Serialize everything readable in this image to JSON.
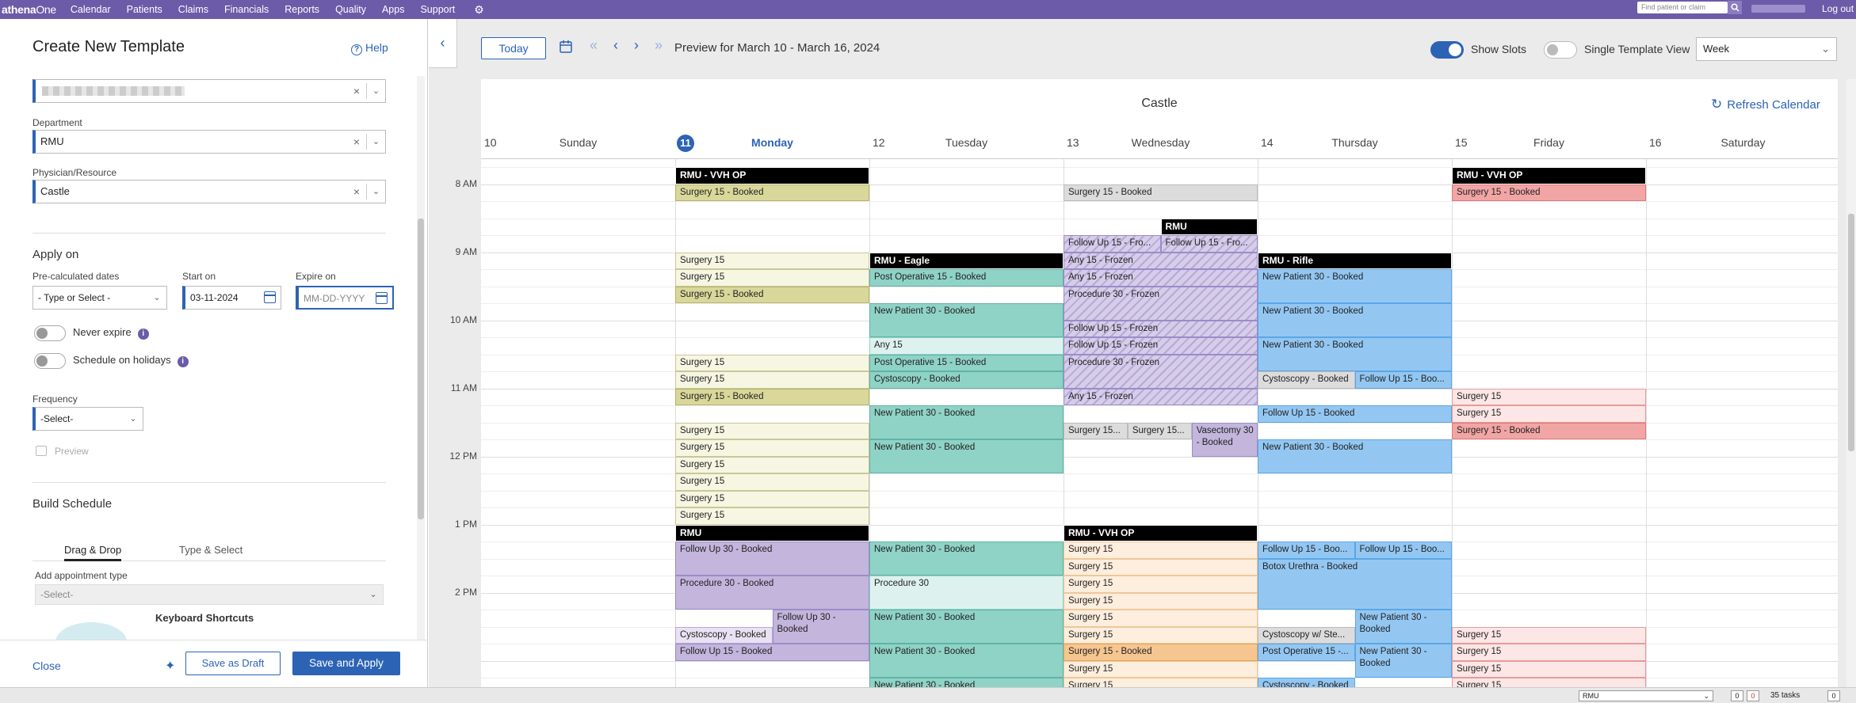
{
  "topnav": {
    "logo_bold": "athena",
    "logo_rest": "One",
    "items": [
      "Calendar",
      "Patients",
      "Claims",
      "Financials",
      "Reports",
      "Quality",
      "Apps",
      "Support"
    ],
    "search_placeholder": "Find patient or claim",
    "logout": "Log out"
  },
  "panel": {
    "title": "Create New Template",
    "help": "Help",
    "department_label": "Department",
    "department_value": "RMU",
    "physician_label": "Physician/Resource",
    "physician_value": "Castle",
    "apply_on_title": "Apply on",
    "precalc_label": "Pre-calculated dates",
    "precalc_value": "- Type or Select -",
    "start_label": "Start on",
    "start_value": "03-11-2024",
    "expire_label": "Expire on",
    "expire_placeholder": "MM-DD-YYYY",
    "never_expire": "Never expire",
    "schedule_holidays": "Schedule on holidays",
    "frequency_label": "Frequency",
    "frequency_value": "-Select-",
    "preview": "Preview",
    "build_schedule": "Build Schedule",
    "tab_drag": "Drag & Drop",
    "tab_type": "Type & Select",
    "add_appt_label": "Add appointment type",
    "add_appt_value": "-Select-",
    "keyboard_shortcuts": "Keyboard Shortcuts",
    "close": "Close",
    "save_draft": "Save as Draft",
    "save_apply": "Save and Apply"
  },
  "toolbar": {
    "today": "Today",
    "preview_label": "Preview for March 10 - March 16, 2024",
    "show_slots": "Show Slots",
    "single_template_view": "Single Template View",
    "view_value": "Week"
  },
  "calendar": {
    "title": "Castle",
    "refresh": "Refresh Calendar",
    "days": [
      {
        "num": "10",
        "name": "Sunday"
      },
      {
        "num": "11",
        "name": "Monday",
        "today": true
      },
      {
        "num": "12",
        "name": "Tuesday"
      },
      {
        "num": "13",
        "name": "Wednesday"
      },
      {
        "num": "14",
        "name": "Thursday"
      },
      {
        "num": "15",
        "name": "Friday"
      },
      {
        "num": "16",
        "name": "Saturday"
      }
    ],
    "times": [
      "8 AM",
      "9 AM",
      "10 AM",
      "11 AM",
      "12 PM",
      "1 PM",
      "2 PM"
    ],
    "events": [
      {
        "day": 1,
        "col": 0,
        "cols": 1,
        "start": 0,
        "len": 1,
        "type": "hdr",
        "text": "RMU - VVH OP"
      },
      {
        "day": 1,
        "col": 0,
        "cols": 1,
        "start": 1,
        "len": 1,
        "type": "yellow",
        "text": "Surgery 15 - Booked"
      },
      {
        "day": 5,
        "col": 0,
        "cols": 1,
        "start": 0,
        "len": 1,
        "type": "hdr",
        "text": "RMU - VVH OP"
      },
      {
        "day": 5,
        "col": 0,
        "cols": 1,
        "start": 1,
        "len": 1,
        "type": "red",
        "text": "Surgery 15 - Booked"
      },
      {
        "day": 3,
        "col": 0,
        "cols": 1,
        "start": 1,
        "len": 1,
        "type": "gray",
        "text": "Surgery 15 - Booked"
      },
      {
        "day": 3,
        "col": 0.5,
        "cols": 0.5,
        "start": 3,
        "len": 1,
        "type": "hdr",
        "text": "RMU"
      },
      {
        "day": 3,
        "col": 0,
        "cols": 0.5,
        "start": 4,
        "len": 1,
        "type": "purpleh",
        "text": "Follow Up 15 - Fro..."
      },
      {
        "day": 3,
        "col": 0.5,
        "cols": 0.5,
        "start": 4,
        "len": 1,
        "type": "purpleh",
        "text": "Follow Up 15 - Fro..."
      },
      {
        "day": 1,
        "col": 0,
        "cols": 1,
        "start": 5,
        "len": 1,
        "type": "yellowl",
        "text": "Surgery 15"
      },
      {
        "day": 1,
        "col": 0,
        "cols": 1,
        "start": 6,
        "len": 1,
        "type": "yellowl",
        "text": "Surgery 15"
      },
      {
        "day": 1,
        "col": 0,
        "cols": 1,
        "start": 7,
        "len": 1,
        "type": "yellow",
        "text": "Surgery 15 - Booked"
      },
      {
        "day": 2,
        "col": 0,
        "cols": 1,
        "start": 5,
        "len": 1,
        "type": "hdr",
        "text": "RMU - Eagle"
      },
      {
        "day": 2,
        "col": 0,
        "cols": 1,
        "start": 6,
        "len": 1,
        "type": "teal",
        "text": "Post Operative 15 - Booked"
      },
      {
        "day": 2,
        "col": 0,
        "cols": 1,
        "start": 8,
        "len": 2,
        "type": "teal",
        "text": "New Patient 30 - Booked"
      },
      {
        "day": 2,
        "col": 0,
        "cols": 1,
        "start": 10,
        "len": 1,
        "type": "teall",
        "text": "Any 15"
      },
      {
        "day": 2,
        "col": 0,
        "cols": 1,
        "start": 11,
        "len": 1,
        "type": "teal",
        "text": "Post Operative 15 - Booked"
      },
      {
        "day": 2,
        "col": 0,
        "cols": 1,
        "start": 12,
        "len": 1,
        "type": "teal",
        "text": "Cystoscopy - Booked"
      },
      {
        "day": 2,
        "col": 0,
        "cols": 1,
        "start": 14,
        "len": 2,
        "type": "teal",
        "text": "New Patient 30 - Booked"
      },
      {
        "day": 2,
        "col": 0,
        "cols": 1,
        "start": 16,
        "len": 2,
        "type": "teal",
        "text": "New Patient 30 - Booked"
      },
      {
        "day": 3,
        "col": 0,
        "cols": 1,
        "start": 5,
        "len": 1,
        "type": "purpleh",
        "text": "Any 15 - Frozen"
      },
      {
        "day": 3,
        "col": 0,
        "cols": 1,
        "start": 6,
        "len": 1,
        "type": "purpleh",
        "text": "Any 15 - Frozen"
      },
      {
        "day": 3,
        "col": 0,
        "cols": 1,
        "start": 7,
        "len": 2,
        "type": "purpleh",
        "text": "Procedure 30 - Frozen"
      },
      {
        "day": 3,
        "col": 0,
        "cols": 1,
        "start": 9,
        "len": 1,
        "type": "purpleh",
        "text": "Follow Up 15 - Frozen"
      },
      {
        "day": 3,
        "col": 0,
        "cols": 1,
        "start": 10,
        "len": 1,
        "type": "purpleh",
        "text": "Follow Up 15 - Frozen"
      },
      {
        "day": 3,
        "col": 0,
        "cols": 1,
        "start": 11,
        "len": 2,
        "type": "purpleh",
        "text": "Procedure 30 - Frozen"
      },
      {
        "day": 3,
        "col": 0,
        "cols": 1,
        "start": 13,
        "len": 1,
        "type": "purpleh",
        "text": "Any 15 - Frozen"
      },
      {
        "day": 4,
        "col": 0,
        "cols": 1,
        "start": 5,
        "len": 1,
        "type": "hdr",
        "text": "RMU - Rifle"
      },
      {
        "day": 4,
        "col": 0,
        "cols": 1,
        "start": 6,
        "len": 2,
        "type": "blue",
        "text": "New Patient 30 - Booked"
      },
      {
        "day": 4,
        "col": 0,
        "cols": 1,
        "start": 8,
        "len": 2,
        "type": "blue",
        "text": "New Patient 30 - Booked"
      },
      {
        "day": 4,
        "col": 0,
        "cols": 1,
        "start": 10,
        "len": 2,
        "type": "blue",
        "text": "New Patient 30 - Booked"
      },
      {
        "day": 4,
        "col": 0,
        "cols": 0.5,
        "start": 12,
        "len": 1,
        "type": "gray",
        "text": "Cystoscopy - Booked"
      },
      {
        "day": 4,
        "col": 0.5,
        "cols": 0.5,
        "start": 12,
        "len": 1,
        "type": "blue",
        "text": "Follow Up 15 - Boo..."
      },
      {
        "day": 4,
        "col": 0,
        "cols": 1,
        "start": 14,
        "len": 1,
        "type": "blue",
        "text": "Follow Up 15 - Booked"
      },
      {
        "day": 4,
        "col": 0,
        "cols": 1,
        "start": 16,
        "len": 2,
        "type": "blue",
        "text": "New Patient 30 - Booked"
      },
      {
        "day": 1,
        "col": 0,
        "cols": 1,
        "start": 11,
        "len": 1,
        "type": "yellowl",
        "text": "Surgery 15"
      },
      {
        "day": 1,
        "col": 0,
        "cols": 1,
        "start": 12,
        "len": 1,
        "type": "yellowl",
        "text": "Surgery 15"
      },
      {
        "day": 1,
        "col": 0,
        "cols": 1,
        "start": 13,
        "len": 1,
        "type": "yellow",
        "text": "Surgery 15 - Booked"
      },
      {
        "day": 1,
        "col": 0,
        "cols": 1,
        "start": 15,
        "len": 1,
        "type": "yellowl",
        "text": "Surgery 15"
      },
      {
        "day": 1,
        "col": 0,
        "cols": 1,
        "start": 16,
        "len": 1,
        "type": "yellowl",
        "text": "Surgery 15"
      },
      {
        "day": 1,
        "col": 0,
        "cols": 1,
        "start": 17,
        "len": 1,
        "type": "yellowl",
        "text": "Surgery 15"
      },
      {
        "day": 1,
        "col": 0,
        "cols": 1,
        "start": 18,
        "len": 1,
        "type": "yellowl",
        "text": "Surgery 15"
      },
      {
        "day": 1,
        "col": 0,
        "cols": 1,
        "start": 19,
        "len": 1,
        "type": "yellowl",
        "text": "Surgery 15"
      },
      {
        "day": 1,
        "col": 0,
        "cols": 1,
        "start": 20,
        "len": 1,
        "type": "yellowl",
        "text": "Surgery 15"
      },
      {
        "day": 3,
        "col": 0,
        "cols": 0.33,
        "start": 15,
        "len": 1,
        "type": "gray",
        "text": "Surgery 15..."
      },
      {
        "day": 3,
        "col": 0.33,
        "cols": 0.33,
        "start": 15,
        "len": 1,
        "type": "gray",
        "text": "Surgery 15..."
      },
      {
        "day": 3,
        "col": 0.66,
        "cols": 0.34,
        "start": 15,
        "len": 2,
        "type": "purple",
        "text": "Vasectomy 30 - Booked",
        "wrap": true
      },
      {
        "day": 5,
        "col": 0,
        "cols": 1,
        "start": 13,
        "len": 1,
        "type": "redl",
        "text": "Surgery 15"
      },
      {
        "day": 5,
        "col": 0,
        "cols": 1,
        "start": 14,
        "len": 1,
        "type": "redl",
        "text": "Surgery 15"
      },
      {
        "day": 5,
        "col": 0,
        "cols": 1,
        "start": 15,
        "len": 1,
        "type": "red",
        "text": "Surgery 15 - Booked"
      },
      {
        "day": 1,
        "col": 0,
        "cols": 1,
        "start": 21,
        "len": 1,
        "type": "hdr",
        "text": "RMU"
      },
      {
        "day": 1,
        "col": 0,
        "cols": 1,
        "start": 22,
        "len": 2,
        "type": "purple",
        "text": "Follow Up 30 - Booked"
      },
      {
        "day": 1,
        "col": 0,
        "cols": 1,
        "start": 24,
        "len": 2,
        "type": "purple",
        "text": "Procedure 30 - Booked"
      },
      {
        "day": 1,
        "col": 0.5,
        "cols": 0.5,
        "start": 26,
        "len": 2,
        "type": "purple",
        "text": "Follow Up 30 - Booked",
        "wrap": true
      },
      {
        "day": 1,
        "col": 0,
        "cols": 0.5,
        "start": 27,
        "len": 1,
        "type": "purplel",
        "text": "Cystoscopy - Booked"
      },
      {
        "day": 1,
        "col": 0,
        "cols": 1,
        "start": 28,
        "len": 1,
        "type": "purple",
        "text": "Follow Up 15 - Booked"
      },
      {
        "day": 2,
        "col": 0,
        "cols": 1,
        "start": 22,
        "len": 2,
        "type": "teal",
        "text": "New Patient 30 - Booked"
      },
      {
        "day": 2,
        "col": 0,
        "cols": 1,
        "start": 24,
        "len": 2,
        "type": "teall",
        "text": "Procedure 30"
      },
      {
        "day": 2,
        "col": 0,
        "cols": 1,
        "start": 26,
        "len": 2,
        "type": "teal",
        "text": "New Patient 30 - Booked"
      },
      {
        "day": 2,
        "col": 0,
        "cols": 1,
        "start": 28,
        "len": 2,
        "type": "teal",
        "text": "New Patient 30 - Booked"
      },
      {
        "day": 2,
        "col": 0,
        "cols": 1,
        "start": 30,
        "len": 1,
        "type": "teal",
        "text": "New Patient 30 - Booked"
      },
      {
        "day": 3,
        "col": 0,
        "cols": 1,
        "start": 21,
        "len": 1,
        "type": "hdr",
        "text": "RMU - VVH OP"
      },
      {
        "day": 3,
        "col": 0,
        "cols": 1,
        "start": 22,
        "len": 1,
        "type": "orangel",
        "text": "Surgery 15"
      },
      {
        "day": 3,
        "col": 0,
        "cols": 1,
        "start": 23,
        "len": 1,
        "type": "orangel",
        "text": "Surgery 15"
      },
      {
        "day": 3,
        "col": 0,
        "cols": 1,
        "start": 24,
        "len": 1,
        "type": "orangel",
        "text": "Surgery 15"
      },
      {
        "day": 3,
        "col": 0,
        "cols": 1,
        "start": 25,
        "len": 1,
        "type": "orangel",
        "text": "Surgery 15"
      },
      {
        "day": 3,
        "col": 0,
        "cols": 1,
        "start": 26,
        "len": 1,
        "type": "orangel",
        "text": "Surgery 15"
      },
      {
        "day": 3,
        "col": 0,
        "cols": 1,
        "start": 27,
        "len": 1,
        "type": "orangel",
        "text": "Surgery 15"
      },
      {
        "day": 3,
        "col": 0,
        "cols": 1,
        "start": 28,
        "len": 1,
        "type": "orange",
        "text": "Surgery 15 - Booked"
      },
      {
        "day": 3,
        "col": 0,
        "cols": 1,
        "start": 29,
        "len": 1,
        "type": "orangel",
        "text": "Surgery 15"
      },
      {
        "day": 3,
        "col": 0,
        "cols": 1,
        "start": 30,
        "len": 1,
        "type": "orangel",
        "text": "Surgery 15"
      },
      {
        "day": 4,
        "col": 0,
        "cols": 0.5,
        "start": 22,
        "len": 1,
        "type": "blue",
        "text": "Follow Up 15 - Boo..."
      },
      {
        "day": 4,
        "col": 0.5,
        "cols": 0.5,
        "start": 22,
        "len": 1,
        "type": "blue",
        "text": "Follow Up 15 - Boo..."
      },
      {
        "day": 4,
        "col": 0,
        "cols": 1,
        "start": 23,
        "len": 3,
        "type": "blue",
        "text": "Botox Urethra - Booked"
      },
      {
        "day": 4,
        "col": 0.5,
        "cols": 0.5,
        "start": 26,
        "len": 2,
        "type": "blue",
        "text": "New Patient 30 - Booked",
        "wrap": true
      },
      {
        "day": 4,
        "col": 0,
        "cols": 0.5,
        "start": 27,
        "len": 1,
        "type": "gray",
        "text": "Cystoscopy w/ Ste..."
      },
      {
        "day": 4,
        "col": 0,
        "cols": 0.5,
        "start": 28,
        "len": 1,
        "type": "blue",
        "text": "Post Operative 15 -..."
      },
      {
        "day": 4,
        "col": 0.5,
        "cols": 0.5,
        "start": 28,
        "len": 2,
        "type": "blue",
        "text": "New Patient 30 - Booked",
        "wrap": true
      },
      {
        "day": 4,
        "col": 0,
        "cols": 0.5,
        "start": 30,
        "len": 1,
        "type": "blue",
        "text": "Cystoscopy - Booked"
      },
      {
        "day": 5,
        "col": 0,
        "cols": 1,
        "start": 27,
        "len": 1,
        "type": "redl",
        "text": "Surgery 15"
      },
      {
        "day": 5,
        "col": 0,
        "cols": 1,
        "start": 28,
        "len": 1,
        "type": "redl",
        "text": "Surgery 15"
      },
      {
        "day": 5,
        "col": 0,
        "cols": 1,
        "start": 29,
        "len": 1,
        "type": "redl",
        "text": "Surgery 15"
      },
      {
        "day": 5,
        "col": 0,
        "cols": 1,
        "start": 30,
        "len": 1,
        "type": "redl",
        "text": "Surgery 15"
      }
    ]
  },
  "statusbar": {
    "select_value": "RMU",
    "badge1": "0",
    "badge2": "0",
    "tasks": "35 tasks",
    "badge3": "0"
  }
}
